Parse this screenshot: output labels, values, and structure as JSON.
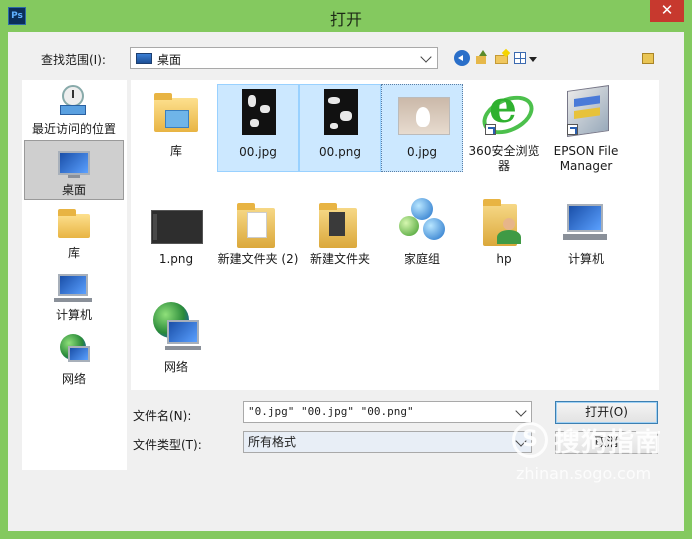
{
  "window": {
    "title": "打开",
    "app_icon_text": "Ps",
    "close_symbol": "✕"
  },
  "lookin": {
    "label": "查找范围(I):",
    "value": "桌面"
  },
  "places": [
    {
      "label": "最近访问的位置",
      "icon": "recent-places-icon"
    },
    {
      "label": "桌面",
      "icon": "desktop-icon",
      "selected": true
    },
    {
      "label": "库",
      "icon": "library-icon"
    },
    {
      "label": "计算机",
      "icon": "computer-icon"
    },
    {
      "label": "网络",
      "icon": "network-icon"
    }
  ],
  "files": [
    {
      "name": "库",
      "icon": "library-folder-icon"
    },
    {
      "name": "00.jpg",
      "icon": "image-thumbnail-icon",
      "selected": true
    },
    {
      "name": "00.png",
      "icon": "image-thumbnail-icon",
      "selected": true
    },
    {
      "name": "0.jpg",
      "icon": "photo-thumbnail-icon",
      "selected": true
    },
    {
      "name": "360安全浏览器",
      "icon": "ie-browser-icon"
    },
    {
      "name": "EPSON File Manager",
      "icon": "epson-icon"
    },
    {
      "name": "1.png",
      "icon": "screenshot-thumbnail-icon"
    },
    {
      "name": "新建文件夹 (2)",
      "icon": "folder-icon"
    },
    {
      "name": "新建文件夹",
      "icon": "folder-icon"
    },
    {
      "name": "家庭组",
      "icon": "homegroup-icon"
    },
    {
      "name": "hp",
      "icon": "user-folder-icon"
    },
    {
      "name": "计算机",
      "icon": "computer-icon"
    },
    {
      "name": "网络",
      "icon": "network-icon"
    }
  ],
  "filename": {
    "label": "文件名(N):",
    "value": "\"0.jpg\" \"00.jpg\" \"00.png\""
  },
  "filetype": {
    "label": "文件类型(T):",
    "value": "所有格式"
  },
  "buttons": {
    "open": "打开(O)",
    "cancel": "取消"
  },
  "watermark": {
    "logo_letter": "S",
    "text": "搜狗指南",
    "url": "zhinan.sogo.com"
  },
  "colors": {
    "titlebar": "#84c95f",
    "selection": "#cce8ff",
    "close": "#c7392e"
  }
}
